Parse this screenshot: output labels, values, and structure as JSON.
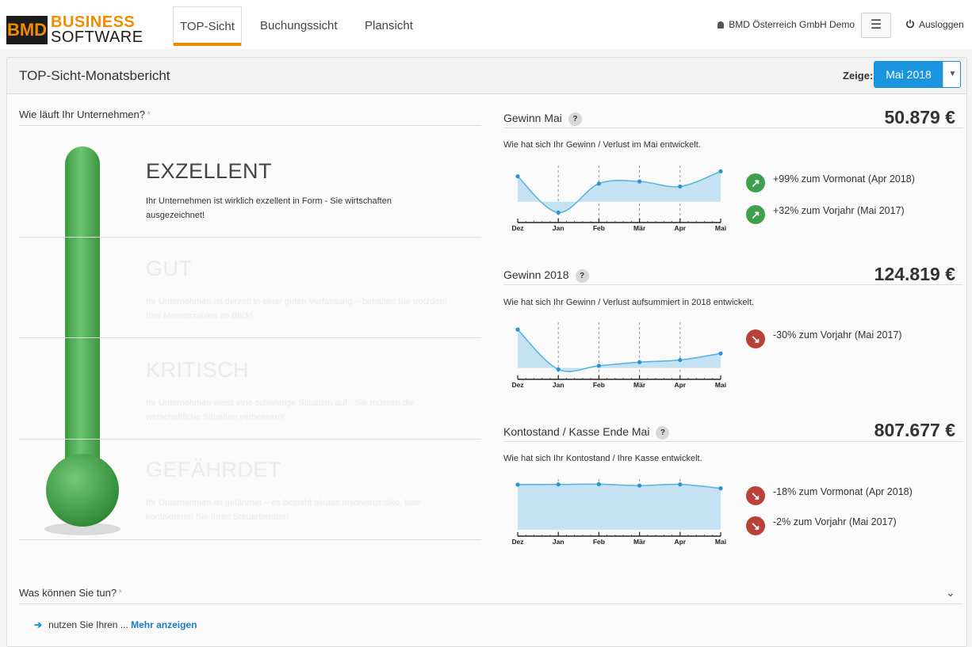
{
  "nav": {
    "logo_mark": "BMD",
    "logo_line1": "BUSINESS",
    "logo_line2": "SOFTWARE",
    "tabs": [
      "TOP-Sicht",
      "Buchungssicht",
      "Plansicht"
    ],
    "user": "BMD Österreich GmbH Demo",
    "menu_icon": "☰",
    "logout": "Ausloggen"
  },
  "header": {
    "title": "TOP-Sicht-Monatsbericht",
    "zeige_label": "Zeige:",
    "month": "Mai 2018",
    "caret": "▼"
  },
  "status": {
    "title": "Wie läuft Ihr Unternehmen?",
    "star": "*",
    "levels": [
      {
        "name": "EXZELLENT",
        "text": "Ihr Unternehmen ist wirklich exzellent in Form - Sie wirtschaften ausgezeichnet!",
        "active": true
      },
      {
        "name": "GUT",
        "text": "Ihr Unternehmen ist derzeit in einer guten Verfassung – behalten Sie trotzdem Ihre Monatszahlen im Blick!",
        "active": false
      },
      {
        "name": "KRITISCH",
        "text": "Ihr Unternehmen weist eine schwierige Situation auf - Sie müssen die wirtschaftliche Situation verbessern!",
        "active": false
      },
      {
        "name": "GEFÄHRDET",
        "text": "Ihr Unternehmen ist gefährdet – es besteht akutes Insolvenzrisiko, bitte kontaktieren Sie Ihren Steuerberater!",
        "active": false
      }
    ],
    "thermometer_level": 1.0
  },
  "kpis": [
    {
      "title": "Gewinn Mai",
      "value": "50.879 €",
      "subtitle": "Wie hat sich Ihr Gewinn / Verlust im Mai entwickelt.",
      "stats": [
        {
          "direction": "up",
          "text": "+99% zum Vormonat (Apr 2018)"
        },
        {
          "direction": "up",
          "text": "+32% zum Vorjahr (Mai 2017)"
        }
      ]
    },
    {
      "title": "Gewinn 2018",
      "value": "124.819 €",
      "subtitle": "Wie hat sich Ihr Gewinn / Verlust aufsummiert in 2018 entwickelt.",
      "stats": [
        {
          "direction": "down",
          "text": "-30% zum Vorjahr (Mai 2017)"
        }
      ]
    },
    {
      "title": "Kontostand / Kasse Ende Mai",
      "value": "807.677 €",
      "subtitle": "Wie hat sich Ihr Kontostand / Ihre Kasse entwickelt.",
      "stats": [
        {
          "direction": "down",
          "text": "-18% zum Vormonat (Apr 2018)"
        },
        {
          "direction": "down",
          "text": "-2% zum Vorjahr (Mai 2017)"
        }
      ]
    }
  ],
  "qmark": "?",
  "chart_data": [
    {
      "type": "area",
      "categories": [
        "Dez",
        "Jan",
        "Feb",
        "Mär",
        "Apr",
        "Mai"
      ],
      "values": [
        35,
        -15,
        25,
        28,
        21,
        42
      ],
      "ylim": [
        -20,
        50
      ],
      "baseline": 0
    },
    {
      "type": "area",
      "categories": [
        "Dez",
        "Jan",
        "Feb",
        "Mär",
        "Apr",
        "Mai"
      ],
      "values": [
        50,
        -5,
        0,
        5,
        8,
        17
      ],
      "ylim": [
        -10,
        60
      ],
      "baseline": -3
    },
    {
      "type": "area",
      "categories": [
        "Dez",
        "Jan",
        "Feb",
        "Mär",
        "Apr",
        "Mai"
      ],
      "values": [
        980,
        985,
        990,
        960,
        985,
        900
      ],
      "ylim": [
        0,
        1100
      ],
      "baseline": 0
    }
  ],
  "todo": {
    "title": "Was können Sie tun?",
    "star": "*",
    "chevron": "⌄",
    "arrow": "➔",
    "item_text": "nutzen Sie Ihren ... ",
    "more_link": "Mehr anzeigen"
  },
  "colors": {
    "accent": "#f08c00",
    "primary": "#1a95e0",
    "green": "#3ea04a",
    "red": "#b94138",
    "chart_fill": "#c5e2f3",
    "chart_line": "#5ab4e0"
  }
}
